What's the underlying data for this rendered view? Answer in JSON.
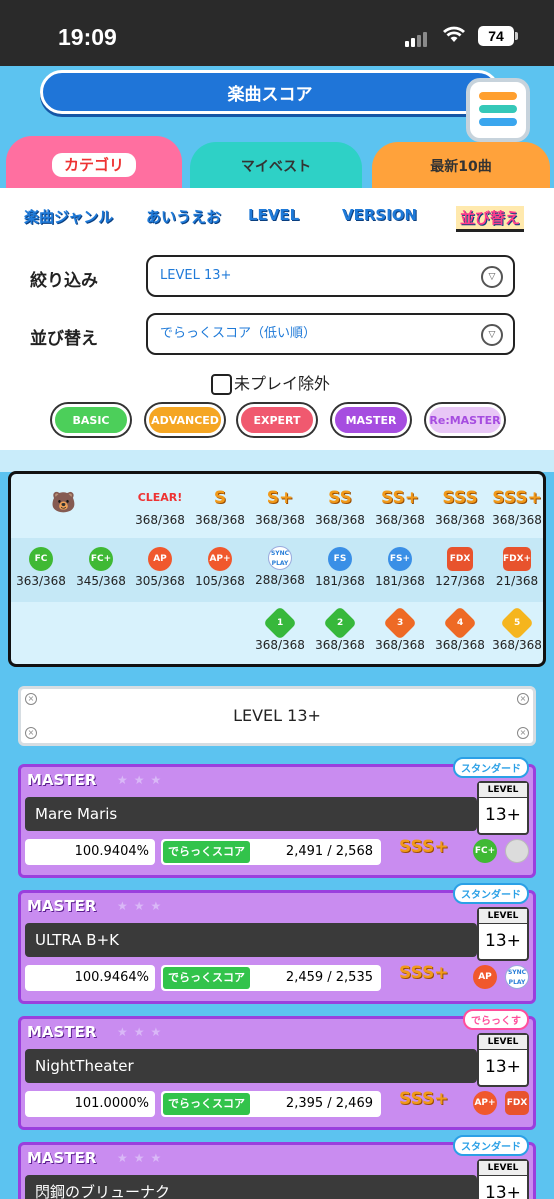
{
  "status": {
    "time": "19:09",
    "battery": "74"
  },
  "header": {
    "title": "楽曲スコア"
  },
  "tabs": [
    {
      "label": "カテゴリ"
    },
    {
      "label": "マイベスト"
    },
    {
      "label": "最新10曲"
    }
  ],
  "categories": [
    {
      "label": "楽曲ジャンル"
    },
    {
      "label": "あいうえお"
    },
    {
      "label": "LEVEL"
    },
    {
      "label": "VERSION"
    },
    {
      "label": "並び替え"
    }
  ],
  "filter": {
    "label": "絞り込み",
    "value": "LEVEL 13+"
  },
  "sort": {
    "label": "並び替え",
    "value": "でらっくスコア（低い順）"
  },
  "exclude_unplayed": {
    "label": "未プレイ除外"
  },
  "difficulties": [
    {
      "label": "BASIC",
      "color": "#4ccf5a"
    },
    {
      "label": "ADVANCED",
      "color": "#f5a623"
    },
    {
      "label": "EXPERT",
      "color": "#f0596f"
    },
    {
      "label": "MASTER",
      "color": "#a64de0"
    },
    {
      "label": "Re:MASTER",
      "color": "#e8c7f6"
    }
  ],
  "stats": {
    "row1": [
      {
        "badge": "CLEAR!",
        "value": "368/368"
      },
      {
        "badge": "S",
        "value": "368/368"
      },
      {
        "badge": "S+",
        "value": "368/368"
      },
      {
        "badge": "SS",
        "value": "368/368"
      },
      {
        "badge": "SS+",
        "value": "368/368"
      },
      {
        "badge": "SSS",
        "value": "368/368"
      },
      {
        "badge": "SSS+",
        "value": "368/368"
      }
    ],
    "row2": [
      {
        "badge": "FC",
        "value": "363/368"
      },
      {
        "badge": "FC+",
        "value": "345/368"
      },
      {
        "badge": "AP",
        "value": "305/368"
      },
      {
        "badge": "AP+",
        "value": "105/368"
      },
      {
        "badge": "SYNC PLAY",
        "value": "288/368"
      },
      {
        "badge": "FS",
        "value": "181/368"
      },
      {
        "badge": "FS+",
        "value": "181/368"
      },
      {
        "badge": "FDX",
        "value": "127/368"
      },
      {
        "badge": "FDX+",
        "value": "21/368"
      }
    ],
    "row3": [
      {
        "badge": "1",
        "value": "368/368"
      },
      {
        "badge": "2",
        "value": "368/368"
      },
      {
        "badge": "3",
        "value": "368/368"
      },
      {
        "badge": "4",
        "value": "368/368"
      },
      {
        "badge": "5",
        "value": "368/368"
      }
    ]
  },
  "level_banner": "LEVEL 13+",
  "songs": [
    {
      "difficulty": "MASTER",
      "type": "スタンダード",
      "title": "Mare Maris",
      "level_label": "LEVEL",
      "level": "13+",
      "achievement": "100.9404%",
      "score_label": "でらっくスコア",
      "dx_score": "2,491 / 2,568",
      "rank": "SSS+",
      "b1": "FC+",
      "b2": ""
    },
    {
      "difficulty": "MASTER",
      "type": "スタンダード",
      "title": "ULTRA B+K",
      "level_label": "LEVEL",
      "level": "13+",
      "achievement": "100.9464%",
      "score_label": "でらっくスコア",
      "dx_score": "2,459 / 2,535",
      "rank": "SSS+",
      "b1": "AP",
      "b2": "SYNC PLAY"
    },
    {
      "difficulty": "MASTER",
      "type": "でらっくす",
      "title": "NightTheater",
      "level_label": "LEVEL",
      "level": "13+",
      "achievement": "101.0000%",
      "score_label": "でらっくスコア",
      "dx_score": "2,395 / 2,469",
      "rank": "SSS+",
      "b1": "AP+",
      "b2": "FDX"
    },
    {
      "difficulty": "MASTER",
      "type": "スタンダード",
      "title": "閃鋼のブリューナク",
      "level_label": "LEVEL",
      "level": "13+",
      "achievement": "",
      "score_label": "",
      "dx_score": "",
      "rank": "",
      "b1": "",
      "b2": ""
    }
  ]
}
